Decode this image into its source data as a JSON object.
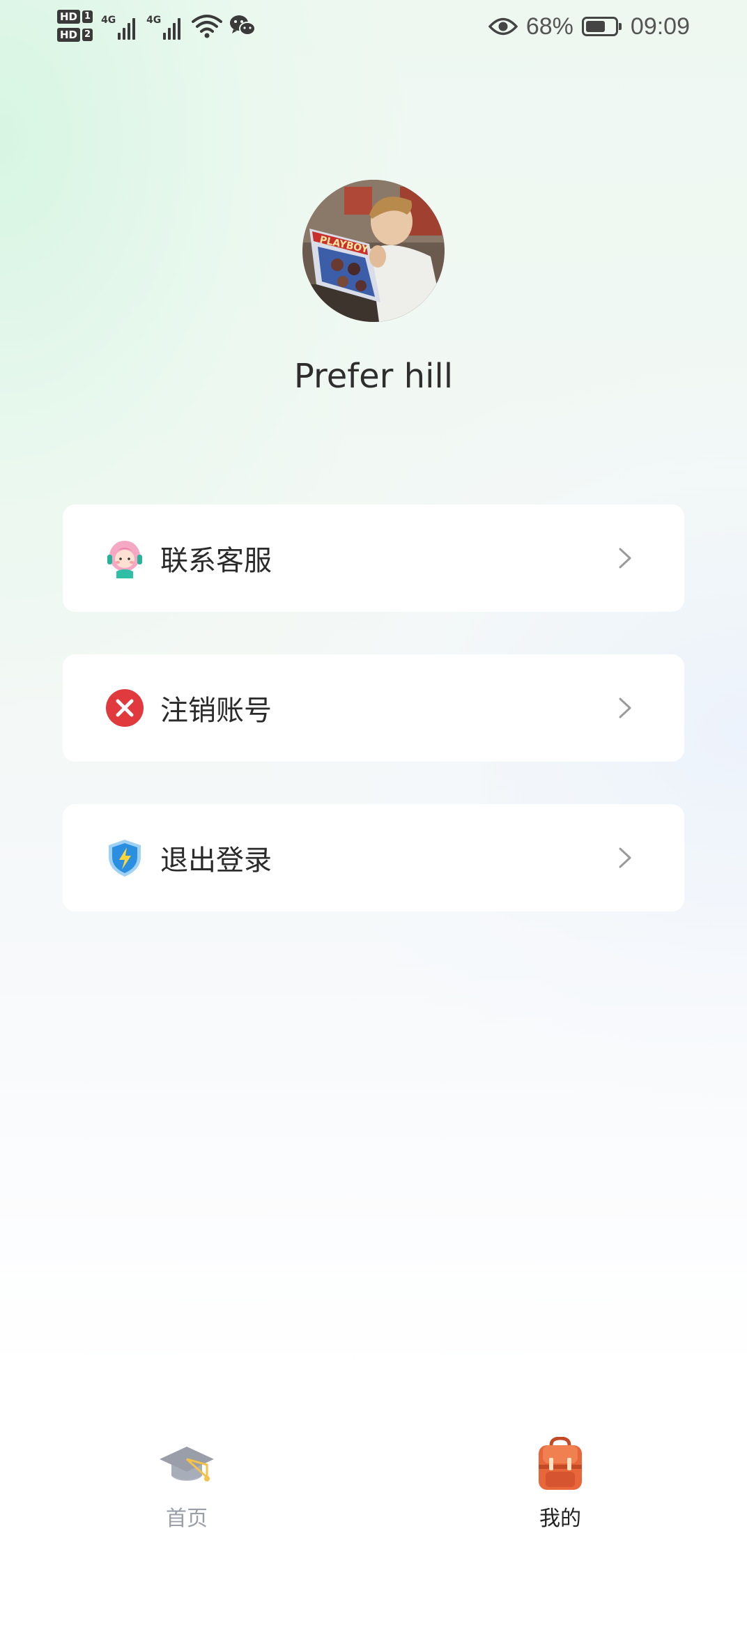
{
  "status_bar": {
    "hd1": "HD",
    "hd1_num": "1",
    "hd2": "HD",
    "hd2_num": "2",
    "network1": "4G",
    "network2": "4G",
    "icons": [
      "signal-icon",
      "wifi-icon",
      "wechat-icon",
      "eye-icon",
      "battery-icon"
    ],
    "battery_percent": "68%",
    "battery_level": 0.68,
    "time": "09:09"
  },
  "profile": {
    "avatar": "avatar-photo",
    "username": "Prefer hill",
    "avatar_magazine_text": "PLAYBOY"
  },
  "menu": {
    "items": [
      {
        "label": "联系客服",
        "icon": "customer-service-icon",
        "icon_color": "#f2a0b8"
      },
      {
        "label": "注销账号",
        "icon": "close-circle-icon",
        "icon_color": "#e0393e"
      },
      {
        "label": "退出登录",
        "icon": "shield-lightning-icon",
        "icon_color": "#2a8fe0"
      }
    ]
  },
  "tab_bar": {
    "tabs": [
      {
        "label": "首页",
        "icon": "graduation-cap-icon",
        "active": false,
        "color": "#9a9ea8"
      },
      {
        "label": "我的",
        "icon": "backpack-icon",
        "active": true,
        "color": "#222222"
      }
    ]
  },
  "colors": {
    "accent_orange": "#e8663a",
    "text_primary": "#2a2a2a",
    "inactive_gray": "#9a9ea8"
  }
}
